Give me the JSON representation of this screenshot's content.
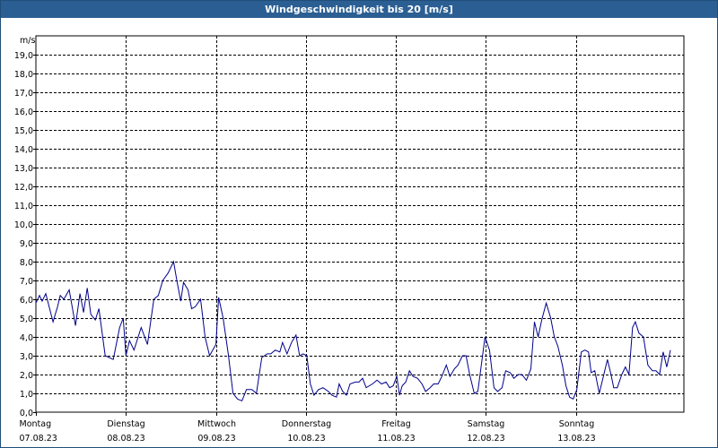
{
  "window": {
    "title": "Windgeschwindigkeit bis 20 [m/s]"
  },
  "colors": {
    "titlebar": "#2b5f93",
    "line": "#00008b",
    "grid": "#000000"
  },
  "chart_data": {
    "type": "line",
    "title": "Windgeschwindigkeit bis 20 [m/s]",
    "ylabel": "m/s",
    "ylim": [
      0,
      20
    ],
    "yticks": [
      "0,0",
      "1,0",
      "2,0",
      "3,0",
      "4,0",
      "5,0",
      "6,0",
      "7,0",
      "8,0",
      "9,0",
      "10,0",
      "11,0",
      "12,0",
      "13,0",
      "14,0",
      "15,0",
      "16,0",
      "17,0",
      "18,0",
      "19,0"
    ],
    "grid": true,
    "xlim": [
      0,
      7.2
    ],
    "days": [
      {
        "x": 0,
        "day": "Montag",
        "date": "07.08.23"
      },
      {
        "x": 1,
        "day": "Dienstag",
        "date": "08.08.23"
      },
      {
        "x": 2,
        "day": "Mittwoch",
        "date": "09.08.23"
      },
      {
        "x": 3,
        "day": "Donnerstag",
        "date": "10.08.23"
      },
      {
        "x": 4,
        "day": "Freitag",
        "date": "11.08.23"
      },
      {
        "x": 5,
        "day": "Samstag",
        "date": "12.08.23"
      },
      {
        "x": 6,
        "day": "Sonntag",
        "date": "13.08.23"
      }
    ],
    "series": [
      {
        "values": [
          [
            0.0,
            5.8
          ],
          [
            0.04,
            6.2
          ],
          [
            0.07,
            5.9
          ],
          [
            0.11,
            6.3
          ],
          [
            0.19,
            4.8
          ],
          [
            0.24,
            5.6
          ],
          [
            0.27,
            6.2
          ],
          [
            0.31,
            6.0
          ],
          [
            0.37,
            6.5
          ],
          [
            0.44,
            4.6
          ],
          [
            0.49,
            6.3
          ],
          [
            0.53,
            5.3
          ],
          [
            0.57,
            6.6
          ],
          [
            0.61,
            5.2
          ],
          [
            0.66,
            4.9
          ],
          [
            0.7,
            5.5
          ],
          [
            0.77,
            3.0
          ],
          [
            0.86,
            2.8
          ],
          [
            0.93,
            4.5
          ],
          [
            0.97,
            5.0
          ],
          [
            1.0,
            3.0
          ],
          [
            1.04,
            3.8
          ],
          [
            1.09,
            3.3
          ],
          [
            1.17,
            4.5
          ],
          [
            1.24,
            3.6
          ],
          [
            1.31,
            6.0
          ],
          [
            1.36,
            6.2
          ],
          [
            1.41,
            7.0
          ],
          [
            1.47,
            7.4
          ],
          [
            1.53,
            8.0
          ],
          [
            1.57,
            6.9
          ],
          [
            1.61,
            5.9
          ],
          [
            1.64,
            6.9
          ],
          [
            1.69,
            6.5
          ],
          [
            1.73,
            5.5
          ],
          [
            1.77,
            5.6
          ],
          [
            1.83,
            6.0
          ],
          [
            1.88,
            4.0
          ],
          [
            1.93,
            3.0
          ],
          [
            2.0,
            3.6
          ],
          [
            2.03,
            6.1
          ],
          [
            2.08,
            5.0
          ],
          [
            2.14,
            3.0
          ],
          [
            2.19,
            1.0
          ],
          [
            2.24,
            0.7
          ],
          [
            2.29,
            0.6
          ],
          [
            2.34,
            1.2
          ],
          [
            2.4,
            1.2
          ],
          [
            2.45,
            1.0
          ],
          [
            2.51,
            2.9
          ],
          [
            2.57,
            3.1
          ],
          [
            2.61,
            3.1
          ],
          [
            2.66,
            3.3
          ],
          [
            2.71,
            3.2
          ],
          [
            2.74,
            3.7
          ],
          [
            2.79,
            3.1
          ],
          [
            2.84,
            3.7
          ],
          [
            2.89,
            4.1
          ],
          [
            2.93,
            3.0
          ],
          [
            2.97,
            3.1
          ],
          [
            3.01,
            3.0
          ],
          [
            3.05,
            1.5
          ],
          [
            3.09,
            0.9
          ],
          [
            3.14,
            1.2
          ],
          [
            3.19,
            1.3
          ],
          [
            3.25,
            1.1
          ],
          [
            3.29,
            0.9
          ],
          [
            3.34,
            0.8
          ],
          [
            3.37,
            1.5
          ],
          [
            3.41,
            1.1
          ],
          [
            3.45,
            0.9
          ],
          [
            3.49,
            1.5
          ],
          [
            3.55,
            1.6
          ],
          [
            3.59,
            1.6
          ],
          [
            3.63,
            1.8
          ],
          [
            3.67,
            1.3
          ],
          [
            3.74,
            1.5
          ],
          [
            3.79,
            1.7
          ],
          [
            3.84,
            1.5
          ],
          [
            3.89,
            1.6
          ],
          [
            3.93,
            1.3
          ],
          [
            3.97,
            1.4
          ],
          [
            4.01,
            1.9
          ],
          [
            4.04,
            0.9
          ],
          [
            4.07,
            1.4
          ],
          [
            4.11,
            1.6
          ],
          [
            4.15,
            2.2
          ],
          [
            4.19,
            1.9
          ],
          [
            4.24,
            1.8
          ],
          [
            4.29,
            1.5
          ],
          [
            4.33,
            1.1
          ],
          [
            4.38,
            1.3
          ],
          [
            4.42,
            1.5
          ],
          [
            4.47,
            1.5
          ],
          [
            4.51,
            1.9
          ],
          [
            4.56,
            2.5
          ],
          [
            4.6,
            1.9
          ],
          [
            4.65,
            2.3
          ],
          [
            4.69,
            2.5
          ],
          [
            4.74,
            3.0
          ],
          [
            4.78,
            3.0
          ],
          [
            4.82,
            2.0
          ],
          [
            4.87,
            1.0
          ],
          [
            4.91,
            1.1
          ],
          [
            4.96,
            2.9
          ],
          [
            4.99,
            4.0
          ],
          [
            5.04,
            3.3
          ],
          [
            5.09,
            1.3
          ],
          [
            5.13,
            1.1
          ],
          [
            5.18,
            1.3
          ],
          [
            5.22,
            2.2
          ],
          [
            5.27,
            2.1
          ],
          [
            5.31,
            1.8
          ],
          [
            5.36,
            2.0
          ],
          [
            5.4,
            2.0
          ],
          [
            5.45,
            1.7
          ],
          [
            5.5,
            2.3
          ],
          [
            5.54,
            4.8
          ],
          [
            5.58,
            4.0
          ],
          [
            5.62,
            4.9
          ],
          [
            5.67,
            5.8
          ],
          [
            5.72,
            5.0
          ],
          [
            5.76,
            4.0
          ],
          [
            5.8,
            3.5
          ],
          [
            5.85,
            2.5
          ],
          [
            5.89,
            1.4
          ],
          [
            5.93,
            0.8
          ],
          [
            5.97,
            0.7
          ],
          [
            6.01,
            1.2
          ],
          [
            6.06,
            3.2
          ],
          [
            6.1,
            3.3
          ],
          [
            6.14,
            3.2
          ],
          [
            6.17,
            2.1
          ],
          [
            6.21,
            2.2
          ],
          [
            6.26,
            1.0
          ],
          [
            6.31,
            2.0
          ],
          [
            6.35,
            2.8
          ],
          [
            6.39,
            2.0
          ],
          [
            6.42,
            1.3
          ],
          [
            6.46,
            1.3
          ],
          [
            6.51,
            2.0
          ],
          [
            6.55,
            2.4
          ],
          [
            6.59,
            2.0
          ],
          [
            6.63,
            4.5
          ],
          [
            6.66,
            4.8
          ],
          [
            6.7,
            4.2
          ],
          [
            6.75,
            4.0
          ],
          [
            6.8,
            2.5
          ],
          [
            6.85,
            2.2
          ],
          [
            6.89,
            2.2
          ],
          [
            6.93,
            2.0
          ],
          [
            6.97,
            3.2
          ],
          [
            7.01,
            2.4
          ],
          [
            7.05,
            3.3
          ]
        ]
      }
    ]
  }
}
